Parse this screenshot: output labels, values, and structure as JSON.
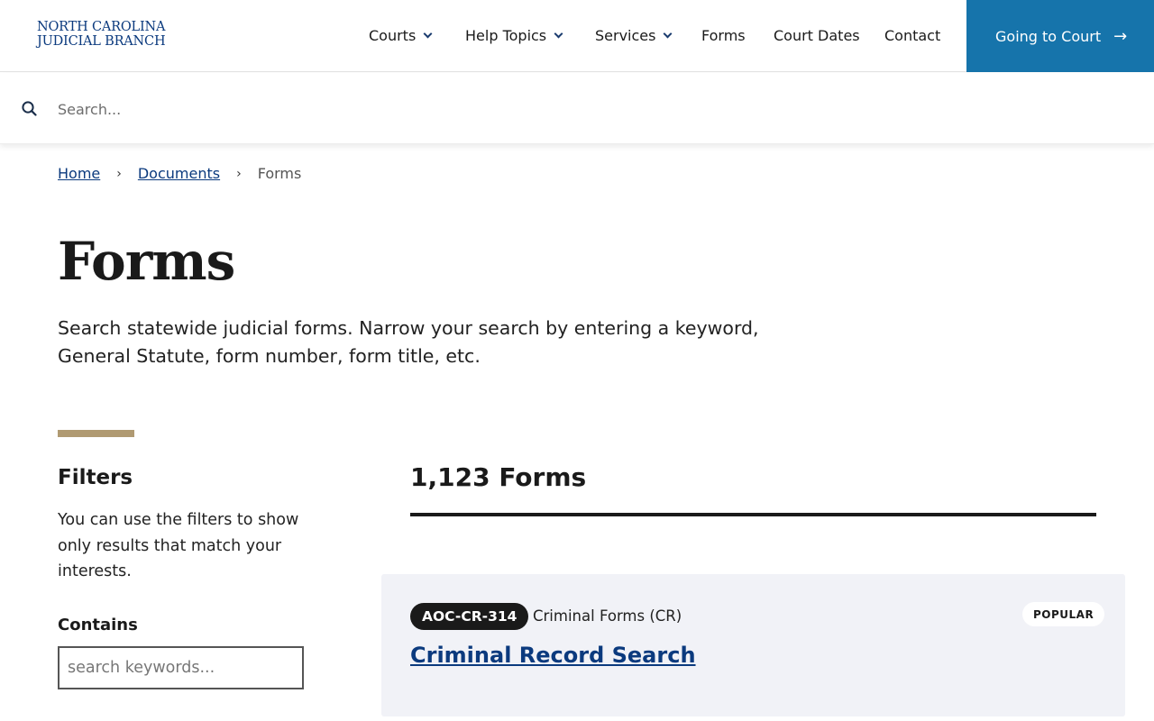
{
  "header": {
    "logo_line1": "NORTH CAROLINA",
    "logo_line2": "JUDICIAL BRANCH",
    "nav": [
      {
        "label": "Courts",
        "has_dropdown": true
      },
      {
        "label": "Help Topics",
        "has_dropdown": true
      },
      {
        "label": "Services",
        "has_dropdown": true
      },
      {
        "label": "Forms",
        "has_dropdown": false
      },
      {
        "label": "Court Dates",
        "has_dropdown": false
      },
      {
        "label": "Contact",
        "has_dropdown": false
      }
    ],
    "cta_label": "Going to Court",
    "cta_icon": "arrow-right-icon",
    "cta_color": "#1674ab"
  },
  "search": {
    "placeholder": "Search...",
    "value": "",
    "icon": "search-icon"
  },
  "breadcrumb": {
    "home": "Home",
    "documents": "Documents",
    "current": "Forms"
  },
  "page": {
    "title": "Forms",
    "intro": "Search statewide judicial forms. Narrow your search by entering a keyword, General Statute, form number, form title, etc."
  },
  "filters": {
    "title": "Filters",
    "description": "You can use the filters to show only results that match your interests.",
    "contains_label": "Contains",
    "keyword_placeholder": "search keywords...",
    "keyword_value": "",
    "accent_color": "#b09a72"
  },
  "results": {
    "count_label": "1,123 Forms",
    "items": [
      {
        "form_number": "AOC-CR-314",
        "category": "Criminal Forms (CR)",
        "badge": "POPULAR",
        "title": "Criminal Record Search"
      }
    ]
  }
}
